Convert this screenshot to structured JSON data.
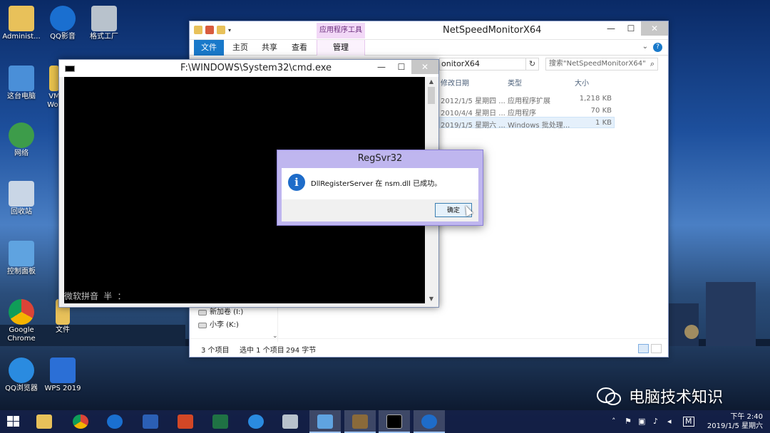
{
  "desktop": {
    "icons": [
      {
        "label": "Administ..."
      },
      {
        "label": "QQ影音"
      },
      {
        "label": "格式工厂"
      },
      {
        "label": "这台电脑"
      },
      {
        "label": "VM"
      },
      {
        "label": "Wor"
      },
      {
        "label": "网络"
      },
      {
        "label": "回收站"
      },
      {
        "label": "控制面板"
      },
      {
        "label": "Google Chrome"
      },
      {
        "label": "文件"
      },
      {
        "label": "QQ浏览器"
      },
      {
        "label": "WPS 2019"
      }
    ]
  },
  "explorer": {
    "title": "NetSpeedMonitorX64",
    "tool_tab": "应用程序工具",
    "ribbon_tabs": [
      "文件",
      "主页",
      "共享",
      "查看"
    ],
    "manage_tab": "管理",
    "address": "onitorX64",
    "search_placeholder": "搜索\"NetSpeedMonitorX64\"",
    "columns": {
      "date": "修改日期",
      "type": "类型",
      "size": "大小"
    },
    "rows": [
      {
        "date": "2012/1/5 星期四 ...",
        "type": "应用程序扩展",
        "size": "1,218 KB"
      },
      {
        "date": "2010/4/4 星期日 ...",
        "type": "应用程序",
        "size": "70 KB"
      },
      {
        "date": "2019/1/5 星期六 ...",
        "type": "Windows 批处理...",
        "size": "1 KB"
      }
    ],
    "nav": [
      {
        "label": "新加卷 (I:)"
      },
      {
        "label": "小李 (K:)"
      }
    ],
    "status": {
      "count": "3 个项目",
      "selected": "选中 1 个项目",
      "bytes": "294 字节"
    }
  },
  "cmd": {
    "title": "F:\\WINDOWS\\System32\\cmd.exe",
    "ime": "微软拼音 半 ："
  },
  "dialog": {
    "title": "RegSvr32",
    "message": "DllRegisterServer 在 nsm.dll 已成功。",
    "ok": "确定"
  },
  "watermark": "电脑技术知识",
  "taskbar": {
    "tray_lang": "M",
    "time": "下午 2:40",
    "date": "2019/1/5 星期六"
  },
  "colors": {
    "accent": "#1979ca",
    "dialog_frame": "#bfb6ef",
    "tool_tab": "#f2d8f7"
  }
}
